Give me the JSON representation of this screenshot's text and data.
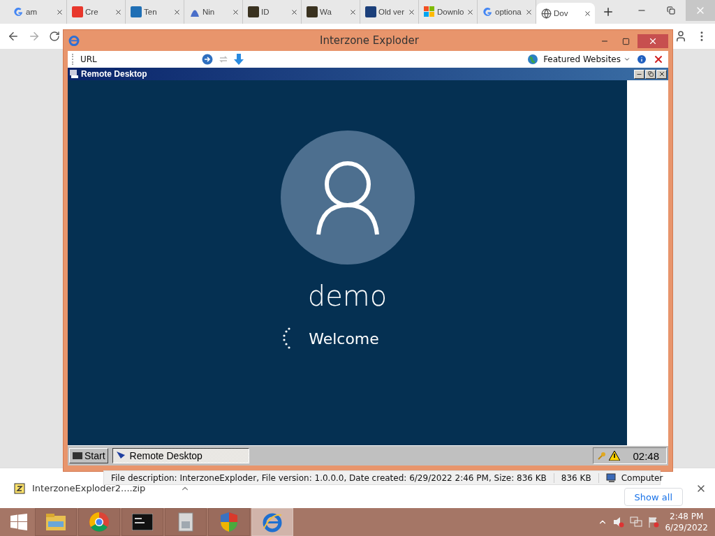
{
  "browser": {
    "tabs": [
      {
        "label": "am",
        "kind": "google",
        "selected": false
      },
      {
        "label": "Cre",
        "kind": "tile",
        "color": "#e8372c",
        "selected": false
      },
      {
        "label": "Ten",
        "kind": "tile",
        "color": "#1f6fb5",
        "selected": false
      },
      {
        "label": "Nin",
        "kind": "blob",
        "color": "#4a6fc9",
        "selected": false
      },
      {
        "label": "ID",
        "kind": "tile",
        "color": "#3a3220",
        "selected": false
      },
      {
        "label": "Wa",
        "kind": "tile",
        "color": "#3a3220",
        "selected": false
      },
      {
        "label": "Old ver",
        "kind": "tile",
        "color": "#1b3f7a",
        "selected": false
      },
      {
        "label": "Downlo",
        "kind": "windows",
        "selected": false
      },
      {
        "label": "optiona",
        "kind": "google",
        "selected": false
      },
      {
        "label": "Dov",
        "kind": "globe",
        "selected": true
      }
    ]
  },
  "app_window": {
    "title": "Interzone Exploder",
    "toolbar": {
      "url_label": "URL",
      "featured": "Featured Websites"
    },
    "remote": {
      "title": "Remote Desktop",
      "user": "demo",
      "status": "Welcome",
      "start": "Start",
      "task": "Remote Desktop",
      "clock": "02:48"
    }
  },
  "status_bar": {
    "description": "File description: InterzoneExploder, File version: 1.0.0.0, Date created: 6/29/2022 2:46 PM, Size: 836 KB",
    "size": "836 KB",
    "zone": "Computer"
  },
  "downloads": {
    "file": "InterzoneExploder2....zip",
    "show_all": "Show all"
  },
  "taskbar": {
    "apps": [
      {
        "kind": "folder",
        "selected": false
      },
      {
        "kind": "chrome",
        "selected": false
      },
      {
        "kind": "console",
        "selected": false
      },
      {
        "kind": "archive",
        "selected": false
      },
      {
        "kind": "shield",
        "selected": false
      },
      {
        "kind": "ie",
        "selected": true
      }
    ],
    "time": "2:48 PM",
    "date": "6/29/2022"
  }
}
